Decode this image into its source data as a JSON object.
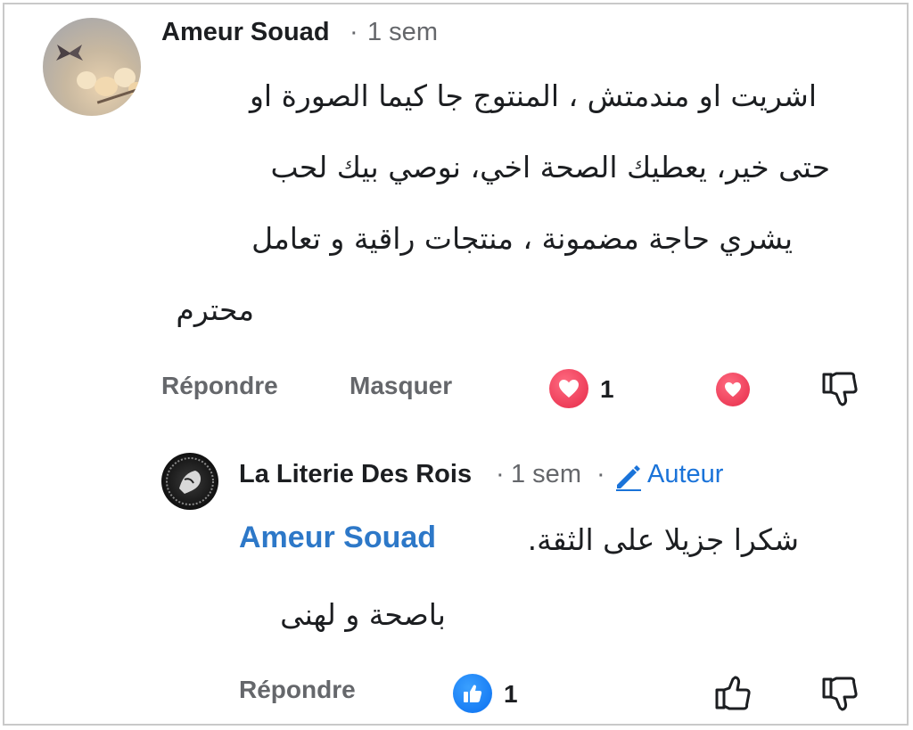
{
  "comment": {
    "author": "Ameur Souad",
    "time": "1 sem",
    "text_lines": [
      "اشريت او مندمتش ، المنتوج جا كيما الصورة او",
      "حتى خير، يعطيك الصحة اخي، نوصي بيك لحب",
      "يشري حاجة مضمونة ، منتجات راقية و تعامل",
      "محترم"
    ],
    "actions": {
      "reply_label": "Répondre",
      "hide_label": "Masquer",
      "reaction_count": "1"
    }
  },
  "reply": {
    "author": "La Literie Des Rois",
    "time": "1 sem",
    "author_badge": "Auteur",
    "mention": "Ameur Souad",
    "text_line1": "شكرا جزيلا على الثقة.",
    "text_line2": "باصحة و لهنى",
    "actions": {
      "reply_label": "Répondre",
      "like_count": "1"
    }
  },
  "colors": {
    "mention": "#2d78c8",
    "badge": "#1a73d9",
    "love": "#e62a48",
    "like": "#0a6ff0",
    "secondary_text": "#65676b"
  },
  "icons": [
    "love-reaction-icon",
    "dislike-icon",
    "like-reaction-icon",
    "like-icon",
    "pencil-icon"
  ]
}
